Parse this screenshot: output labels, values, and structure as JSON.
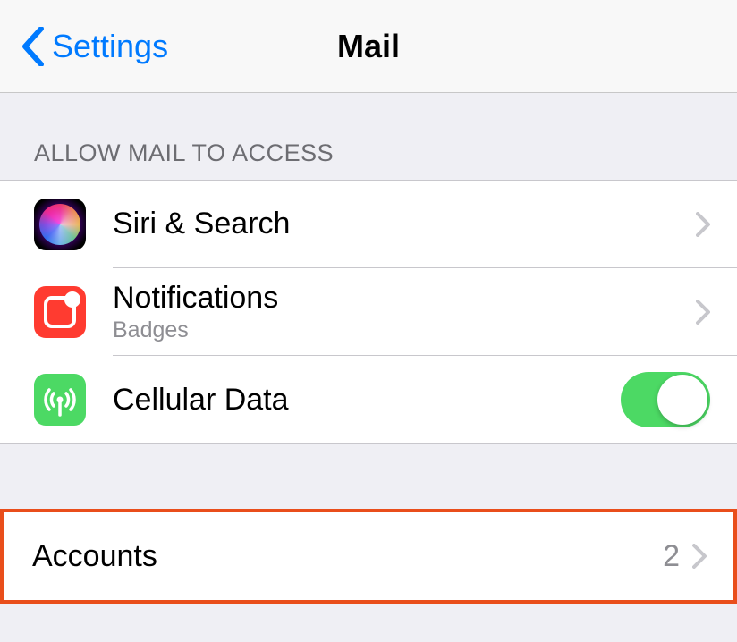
{
  "nav": {
    "back_label": "Settings",
    "title": "Mail"
  },
  "sections": {
    "allow_access": {
      "header": "ALLOW MAIL TO ACCESS",
      "siri_search": {
        "label": "Siri & Search"
      },
      "notifications": {
        "label": "Notifications",
        "sublabel": "Badges"
      },
      "cellular_data": {
        "label": "Cellular Data",
        "toggle_on": true
      }
    },
    "accounts": {
      "label": "Accounts",
      "count": "2"
    }
  }
}
